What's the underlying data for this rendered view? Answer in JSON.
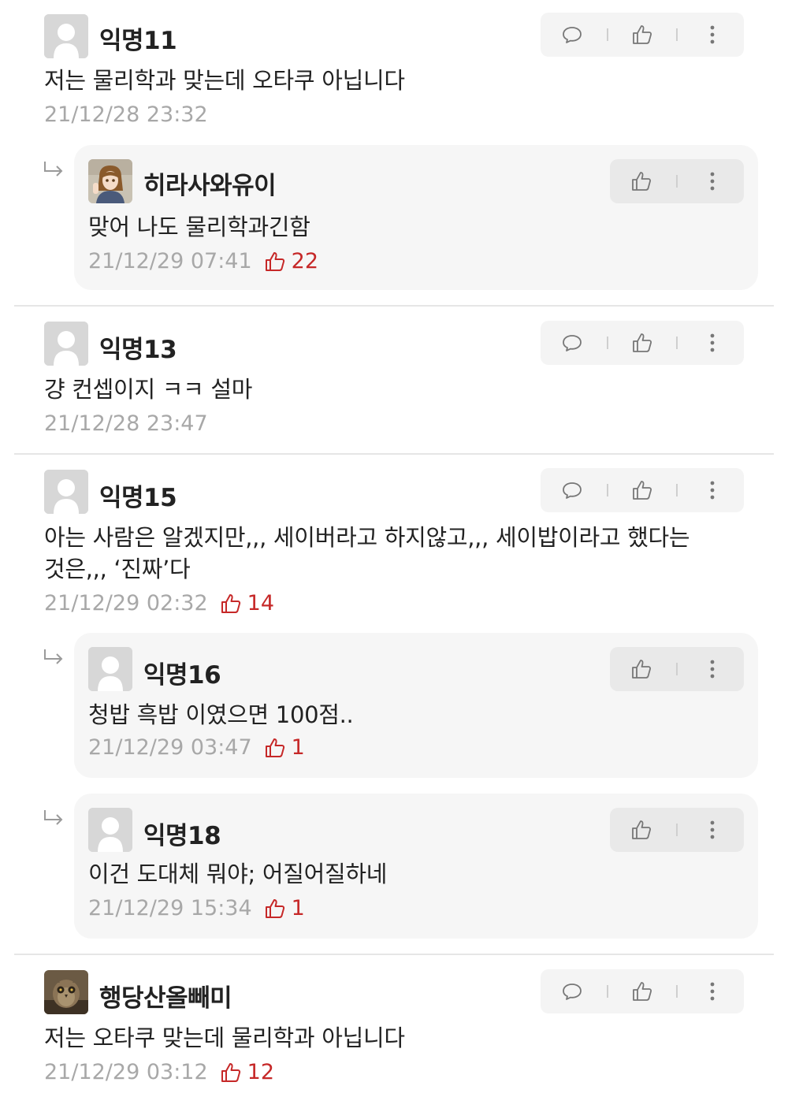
{
  "comments": [
    {
      "author": "익명11",
      "text": "저는 물리학과 맞는데 오타쿠 아닙니다",
      "date": "21/12/28 23:32",
      "replies": [
        {
          "author": "히라사와유이",
          "text": "맞어 나도 물리학과긴함",
          "date": "21/12/29 07:41",
          "likes": "22"
        }
      ]
    },
    {
      "author": "익명13",
      "text": "걍 컨셉이지 ㅋㅋ 설마",
      "date": "21/12/28 23:47"
    },
    {
      "author": "익명15",
      "text_line1": "아는 사람은 알겠지만,,, 세이버라고 하지않고,,, 세이밥이라고 했다는",
      "text_line2": "것은,,, ‘진짜’다",
      "date": "21/12/29 02:32",
      "likes": "14",
      "replies": [
        {
          "author": "익명16",
          "text": "청밥 흑밥 이였으면 100점..",
          "date": "21/12/29 03:47",
          "likes": "1"
        },
        {
          "author": "익명18",
          "text": "이건 도대체 뭐야; 어질어질하네",
          "date": "21/12/29 15:34",
          "likes": "1"
        }
      ]
    },
    {
      "author": "행당산올빼미",
      "text": "저는 오타쿠 맞는데 물리학과 아닙니다",
      "date": "21/12/29 03:12",
      "likes": "12"
    }
  ],
  "icons": {
    "reply": "speech-bubble-icon",
    "like": "thumbs-up-icon",
    "more": "more-vertical-icon",
    "reply_indicator": "reply-arrow-icon"
  },
  "colors": {
    "like_accent": "#c62828",
    "date_gray": "#a8a8a8",
    "reply_background": "#f6f6f6"
  }
}
